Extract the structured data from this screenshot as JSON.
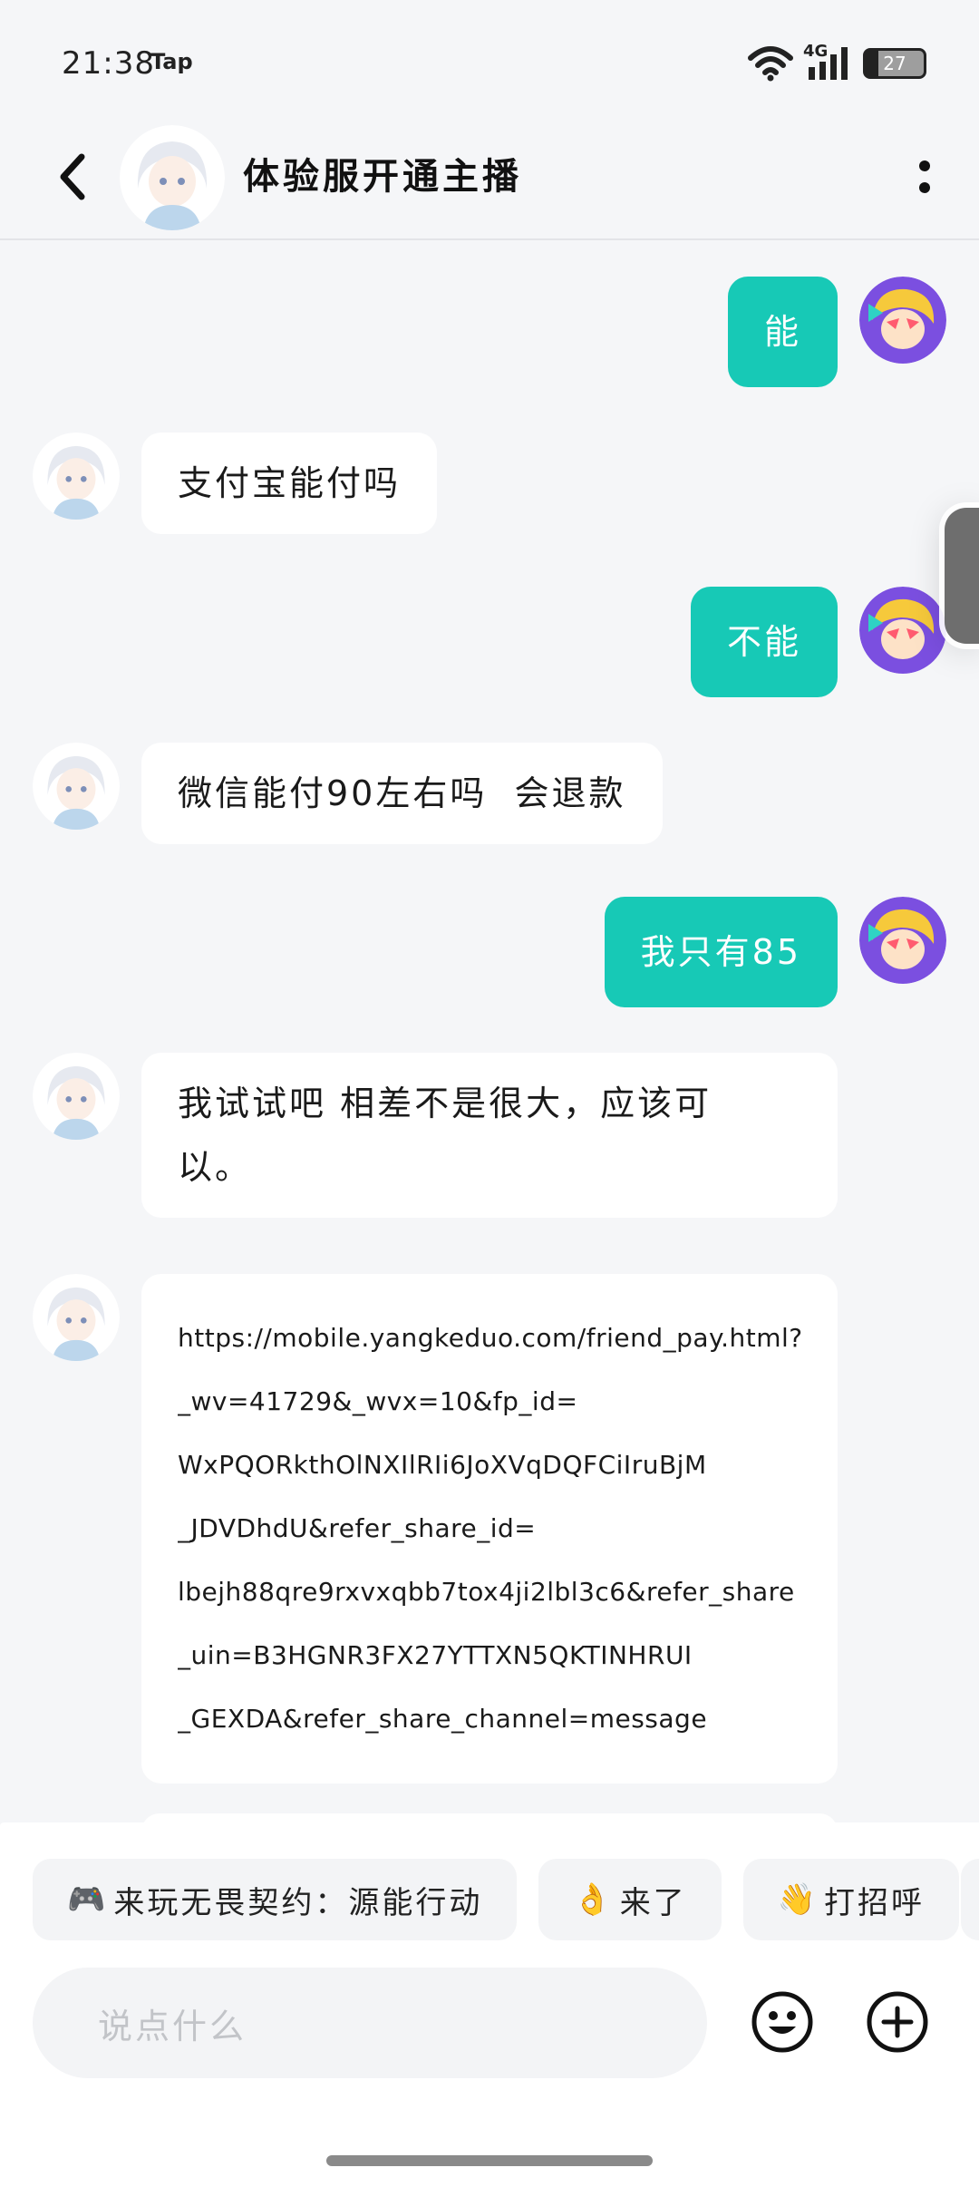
{
  "status_bar": {
    "time": "21:38",
    "app_badge": "Tap",
    "network": "4G",
    "battery": "27"
  },
  "header": {
    "title": "体验服开通主播",
    "back_icon": "chevron-left-icon",
    "more_icon": "more-vertical-icon"
  },
  "messages": [
    {
      "side": "out",
      "text": "能"
    },
    {
      "side": "in",
      "text": "支付宝能付吗"
    },
    {
      "side": "out",
      "text": "不能"
    },
    {
      "side": "in",
      "text": "微信能付90左右吗  会退款"
    },
    {
      "side": "out",
      "text": "我只有85"
    },
    {
      "side": "in",
      "lines": [
        "我试试吧 相差不是很大，应该可",
        "以。"
      ]
    },
    {
      "side": "in",
      "link_lines": [
        "https://mobile.yangkeduo.com/friend_pay.html?",
        "_wv=41729&_wvx=10&fp_id=",
        "WxPQORkthOlNXIlRIi6JoXVqDQFCiIruBjM",
        "_JDVDhdU&refer_share_id=",
        "lbejh88qre9rxvxqbb7tox4ji2lbl3c6&refer_share",
        "_uin=B3HGNR3FX27YTTXN5QKTINHRUI",
        "_GEXDA&refer_share_channel=message"
      ]
    }
  ],
  "quick_replies": [
    {
      "emoji": "🎮",
      "label": "来玩无畏契约：源能行动"
    },
    {
      "emoji": "👌",
      "label": "来了"
    },
    {
      "emoji": "👋",
      "label": "打招呼"
    }
  ],
  "composer": {
    "placeholder": "说点什么",
    "emoji_icon": "smiley-icon",
    "plus_icon": "plus-circle-icon"
  },
  "colors": {
    "accent": "#17c9b6",
    "background": "#f5f6f8"
  }
}
